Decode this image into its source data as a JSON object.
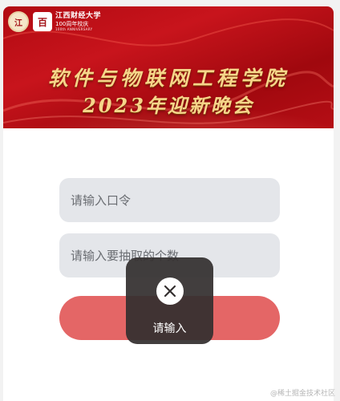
{
  "banner": {
    "logo": {
      "seal_text": "江",
      "badge_text": "百",
      "name": "江西财经大学",
      "sub": "100周年校庆",
      "en": "100th ANNIVERSARY"
    },
    "title_line1": "软件与物联网工程学院",
    "title_line2": "2023年迎新晚会"
  },
  "form": {
    "code_placeholder": "请输入口令",
    "code_value": "",
    "count_placeholder": "请输入要抽取的个数",
    "count_value": "",
    "submit_label": ""
  },
  "toast": {
    "icon": "close-icon",
    "message": "请输入"
  },
  "watermark": "@稀土掘金技术社区",
  "colors": {
    "banner_red": "#c8141c",
    "title_gold": "#f6d58a",
    "input_bg": "#e4e6ea",
    "button_red": "#e46666",
    "toast_bg": "#342f2f"
  }
}
